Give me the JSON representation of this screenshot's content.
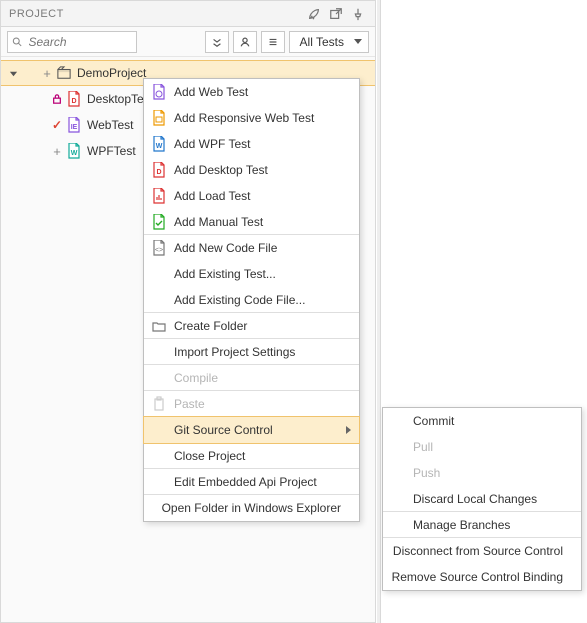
{
  "panel": {
    "title": "PROJECT",
    "search_placeholder": "Search",
    "filter_label": "All Tests"
  },
  "tree": {
    "root": "DemoProject",
    "items": [
      {
        "label": "DesktopTest"
      },
      {
        "label": "WebTest"
      },
      {
        "label": "WPFTest"
      }
    ]
  },
  "context_menu": [
    {
      "label": "Add Web Test"
    },
    {
      "label": "Add Responsive Web Test"
    },
    {
      "label": "Add WPF Test"
    },
    {
      "label": "Add Desktop Test"
    },
    {
      "label": "Add Load Test"
    },
    {
      "label": "Add Manual Test"
    },
    {
      "label": "Add New Code File"
    },
    {
      "label": "Add Existing Test..."
    },
    {
      "label": "Add Existing Code File..."
    },
    {
      "label": "Create Folder"
    },
    {
      "label": "Import Project Settings"
    },
    {
      "label": "Compile"
    },
    {
      "label": "Paste"
    },
    {
      "label": "Git Source Control"
    },
    {
      "label": "Close Project"
    },
    {
      "label": "Edit Embedded Api Project"
    },
    {
      "label": "Open Folder in Windows Explorer"
    }
  ],
  "git_submenu": [
    {
      "label": "Commit"
    },
    {
      "label": "Pull"
    },
    {
      "label": "Push"
    },
    {
      "label": "Discard Local Changes"
    },
    {
      "label": "Manage Branches"
    },
    {
      "label": "Disconnect from Source Control"
    },
    {
      "label": "Remove Source Control Binding"
    }
  ]
}
